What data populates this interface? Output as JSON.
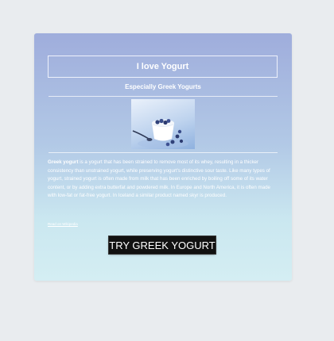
{
  "card": {
    "title": "I love Yogurt",
    "subtitle": "Especially Greek Yogurts",
    "description_lead": "Greek yogurt",
    "description_body": " is a yogurt that has been strained to remove most of its whey, resulting in a thicker consistency than unstrained yogurt, while preserving yogurt's distinctive sour taste. Like many types of yogurt, strained yogurt is often made from milk that has been enriched by boiling off some of its water content, or by adding extra butterfat and powdered milk. In Europe and North America, it is often made with low-fat or fat-free yogurt. In Iceland a similar product named skyr is produced.",
    "source_link": "Read on Wikipedia",
    "cta_label": "TRY GREEK YOGURT"
  },
  "image": {
    "subject": "yogurt-with-blueberries-image"
  },
  "colors": {
    "page_background": "#e9ecef",
    "gradient_top": "#9faddc",
    "gradient_bottom": "#d4eef3",
    "button_background": "#111111",
    "text": "#ffffff"
  }
}
